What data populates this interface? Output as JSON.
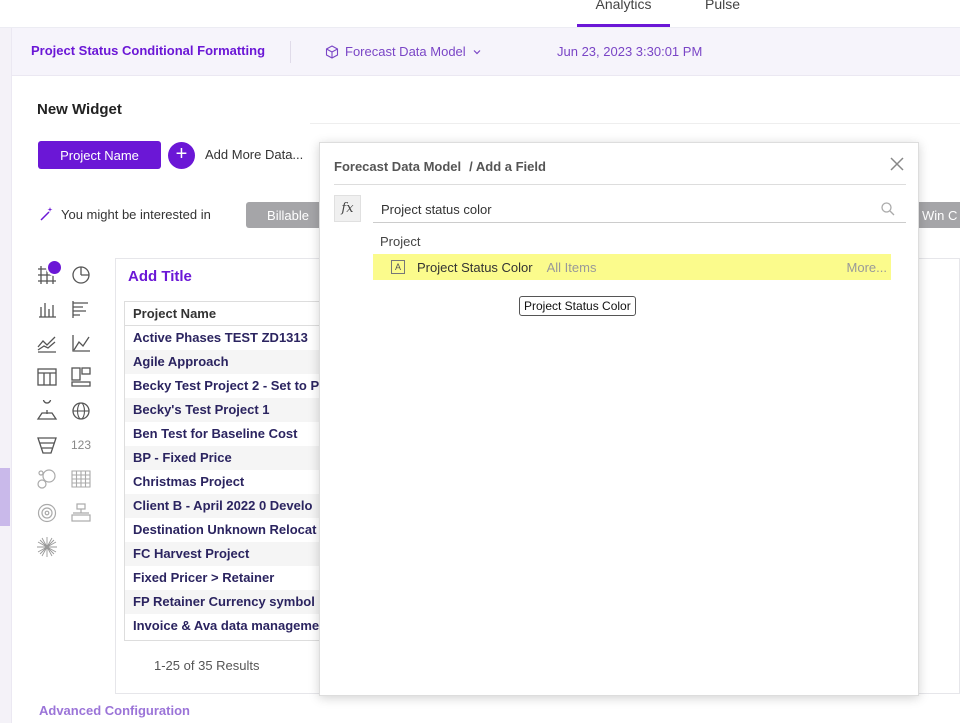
{
  "topnav": {
    "tabs": [
      {
        "label": "Analytics"
      },
      {
        "label": "Pulse"
      }
    ]
  },
  "context": {
    "project": "Project Status Conditional Formatting",
    "model": "Forecast Data Model",
    "datetime": "Jun 23, 2023 3:30:01 PM"
  },
  "widget": {
    "title": "New Widget",
    "pill": "Project Name",
    "add_more": "Add More Data...",
    "interested": "You might be interested in",
    "chips": [
      "Billable",
      "Win C"
    ]
  },
  "chart_types": {
    "number_icon": "123"
  },
  "table": {
    "add_title": "Add Title",
    "header": "Project Name",
    "rows": [
      "Active Phases TEST ZD1313",
      "Agile Approach",
      "Becky Test Project 2 - Set to Pl",
      "Becky's Test Project 1",
      "Ben Test for Baseline Cost",
      "BP - Fixed Price",
      "Christmas Project",
      "Client B - April 2022 0 Develo",
      "Destination Unknown Relocat",
      "FC Harvest Project",
      "Fixed Pricer > Retainer",
      "FP Retainer Currency symbol",
      "Invoice & Ava data manageme"
    ],
    "results": "1-25 of 35 Results"
  },
  "advanced": "Advanced Configuration",
  "modal": {
    "model": "Forecast Data Model",
    "crumb": "/ Add a Field",
    "fx": "fx",
    "search_value": "Project status color",
    "group": "Project",
    "hit": {
      "icon": "A",
      "name": "Project Status Color",
      "scope": "All Items",
      "more": "More..."
    },
    "tooltip": "Project Status Color"
  },
  "colors": {
    "accent": "#6b17d6",
    "highlight": "#fbfb8c"
  }
}
